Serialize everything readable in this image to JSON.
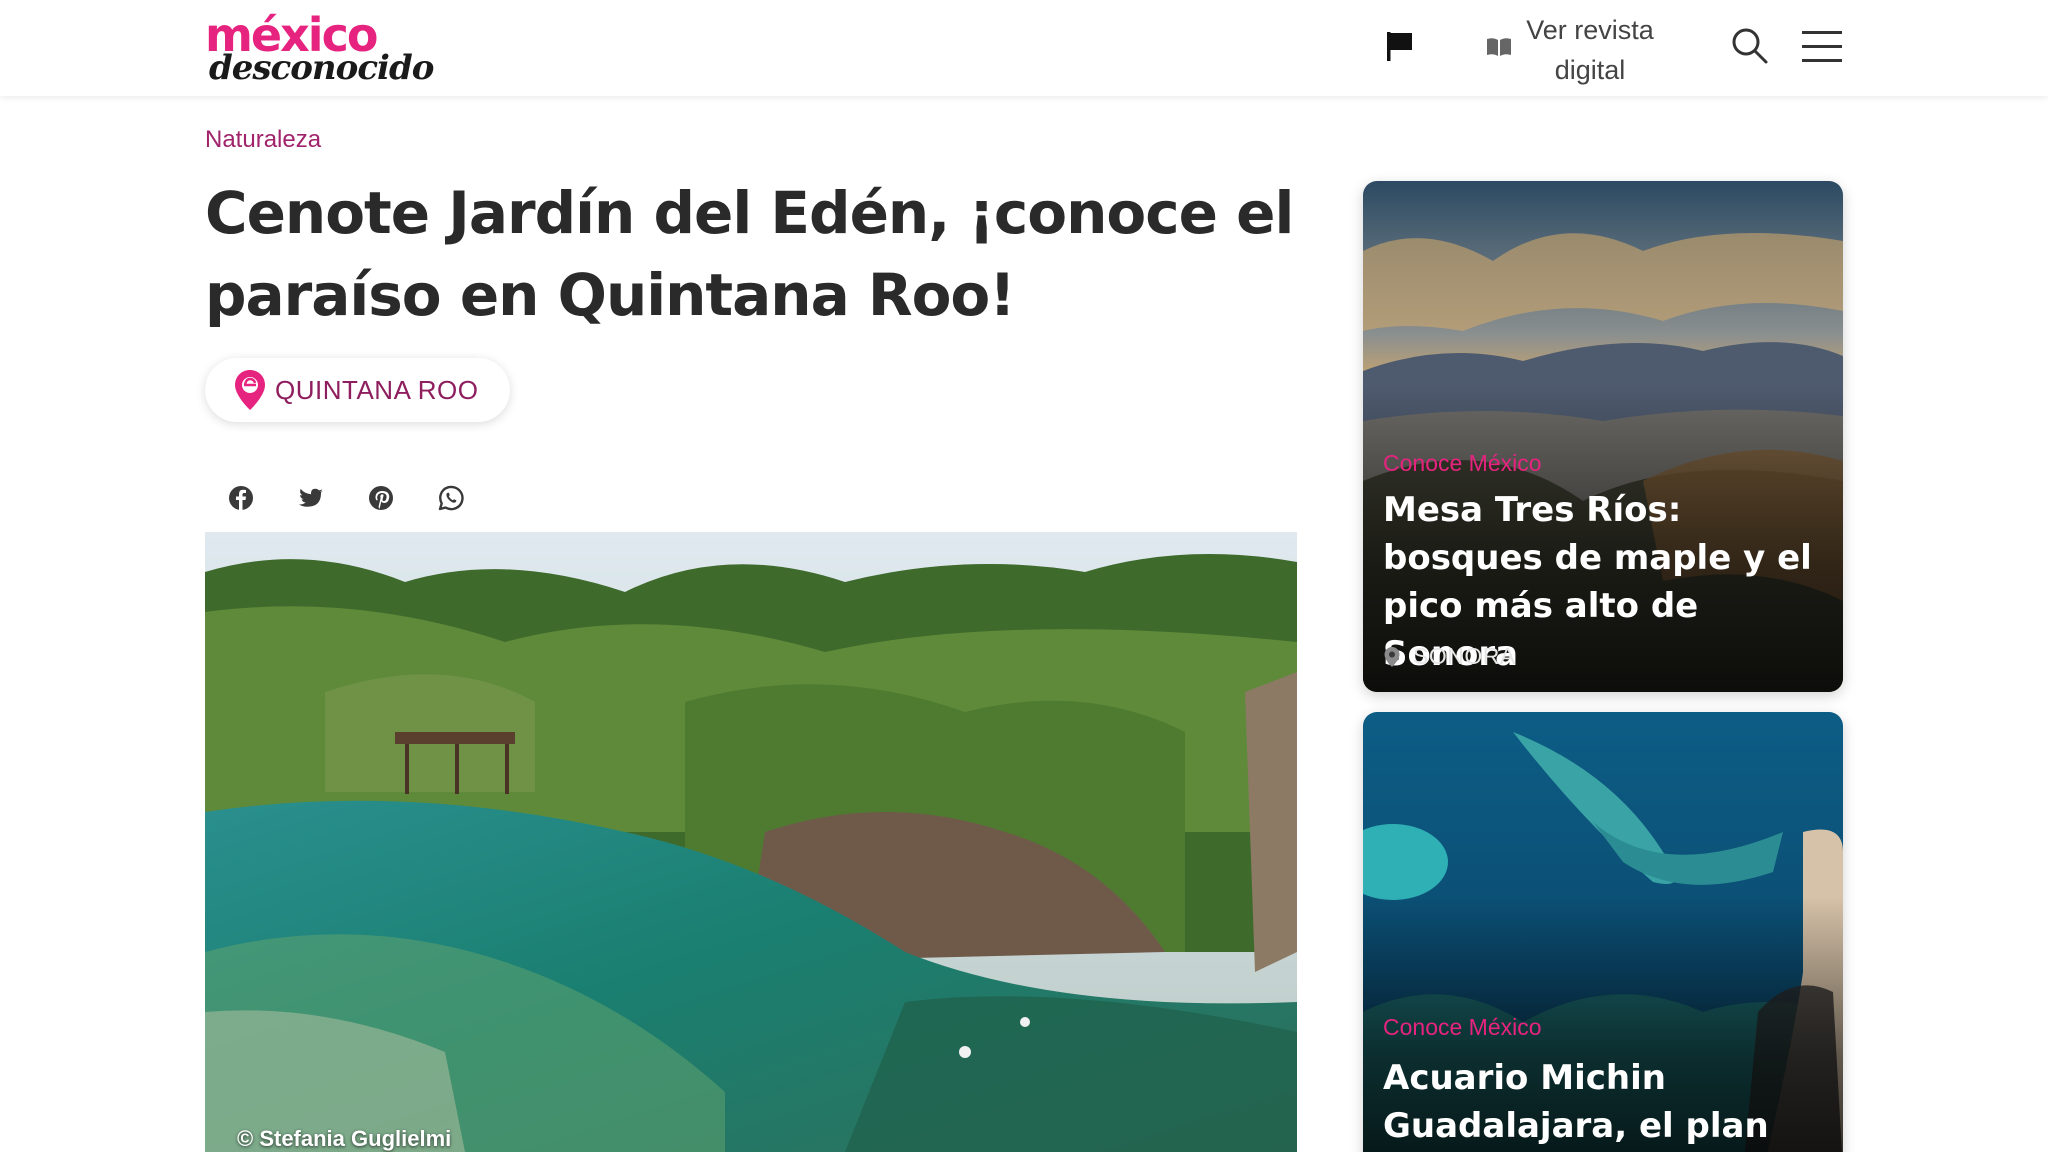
{
  "header": {
    "logo_top": "méxico",
    "logo_bottom": "desconocido",
    "magazine_line1": "Ver revista",
    "magazine_line2": "digital",
    "icons": [
      "flag-icon",
      "book-icon",
      "search-icon",
      "menu-icon"
    ]
  },
  "article": {
    "category": "Naturaleza",
    "title": "Cenote Jardín del Edén, ¡conoce el paraíso en Quintana Roo!",
    "location": "QUINTANA ROO",
    "share_icons": [
      "facebook-icon",
      "twitter-icon",
      "pinterest-icon",
      "whatsapp-icon"
    ],
    "image_credit": "© Stefania Guglielmi"
  },
  "sidebar": {
    "cards": [
      {
        "category": "Conoce México",
        "title": "Mesa Tres Ríos: bosques de maple y el pico más alto de Sonora",
        "location": "SONORA"
      },
      {
        "category": "Conoce México",
        "title": "Acuario Michin Guadalajara, el plan"
      }
    ]
  },
  "colors": {
    "brand_pink": "#e6247f",
    "category_purple": "#a0236b",
    "text_dark": "#2a2a2a"
  }
}
